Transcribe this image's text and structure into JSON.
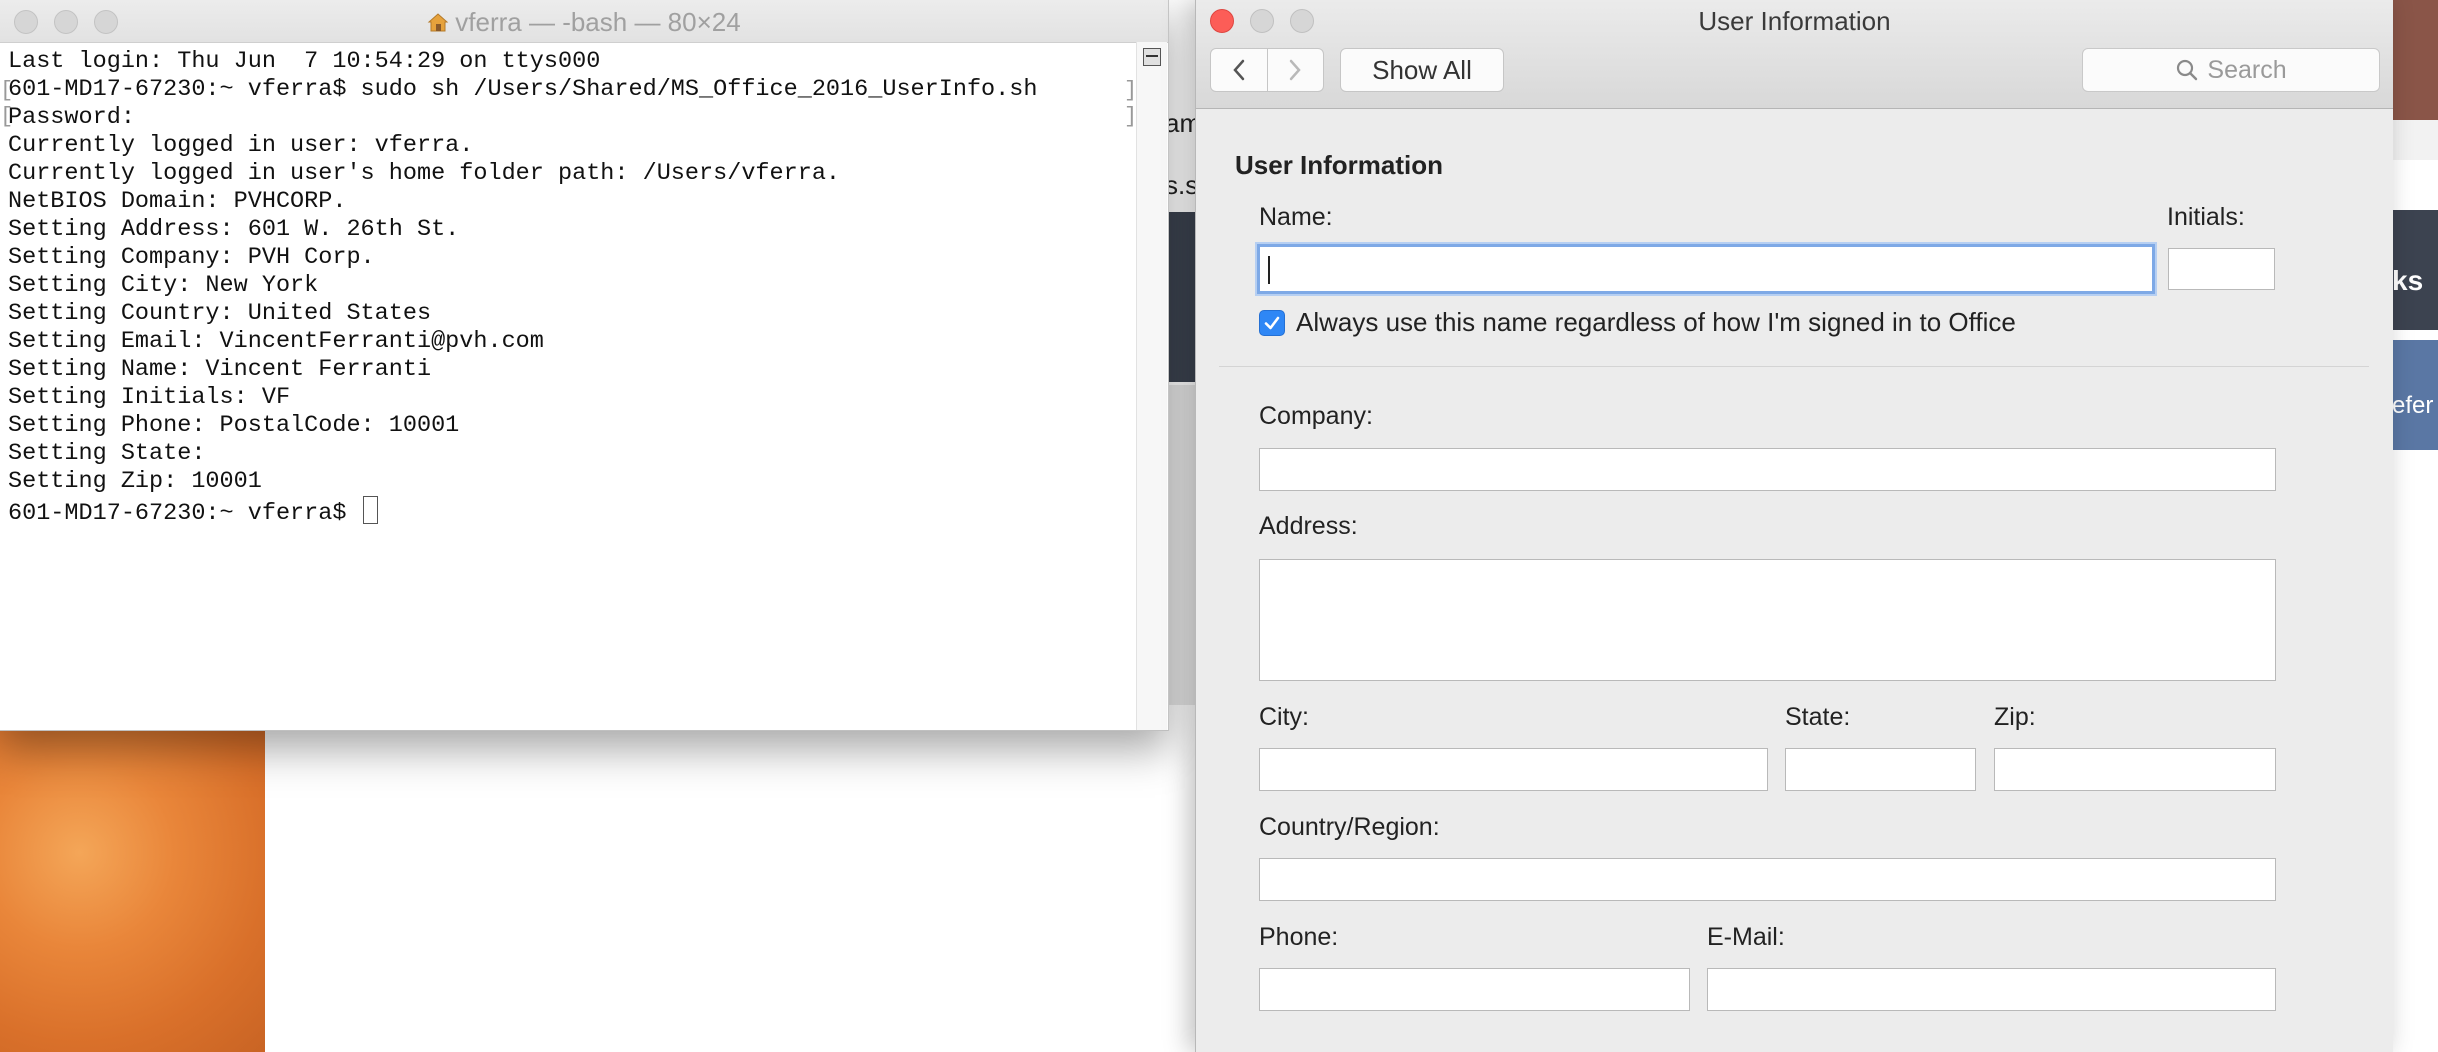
{
  "terminal": {
    "title": "vferra — -bash — 80×24",
    "lines": [
      "Last login: Thu Jun  7 10:54:29 on ttys000",
      "601-MD17-67230:~ vferra$ sudo sh /Users/Shared/MS_Office_2016_UserInfo.sh",
      "Password:",
      "Currently logged in user: vferra.",
      "Currently logged in user's home folder path: /Users/vferra.",
      "NetBIOS Domain: PVHCORP.",
      "Setting Address: 601 W. 26th St.",
      "Setting Company: PVH Corp.",
      "Setting City: New York",
      "Setting Country: United States",
      "Setting Email: VincentFerranti@pvh.com",
      "Setting Name: Vincent Ferranti",
      "Setting Initials: VF",
      "Setting Phone: PostalCode: 10001",
      "Setting State:",
      "Setting Zip: 10001"
    ],
    "prompt": "601-MD17-67230:~ vferra$ "
  },
  "userinfo": {
    "window_title": "User Information",
    "show_all_label": "Show All",
    "search_placeholder": "Search",
    "section_title": "User Information",
    "name_label": "Name:",
    "name_value": "",
    "initials_label": "Initials:",
    "initials_value": "",
    "always_use_label": "Always use this name regardless of how I'm signed in to Office",
    "always_use_checked": true,
    "company_label": "Company:",
    "company_value": "",
    "address_label": "Address:",
    "address_value": "",
    "city_label": "City:",
    "city_value": "",
    "state_label": "State:",
    "state_value": "",
    "zip_label": "Zip:",
    "zip_value": "",
    "country_label": "Country/Region:",
    "country_value": "",
    "phone_label": "Phone:",
    "phone_value": "",
    "email_label": "E-Mail:",
    "email_value": ""
  },
  "background": {
    "peek_text_1": "am",
    "peek_text_2": "s.s",
    "right_peek_1": "ks",
    "right_peek_2": "efer"
  },
  "colors": {
    "close_red": "#fc5d57",
    "checkbox_blue": "#2f87f5",
    "focus_ring": "#7ea9e6"
  }
}
